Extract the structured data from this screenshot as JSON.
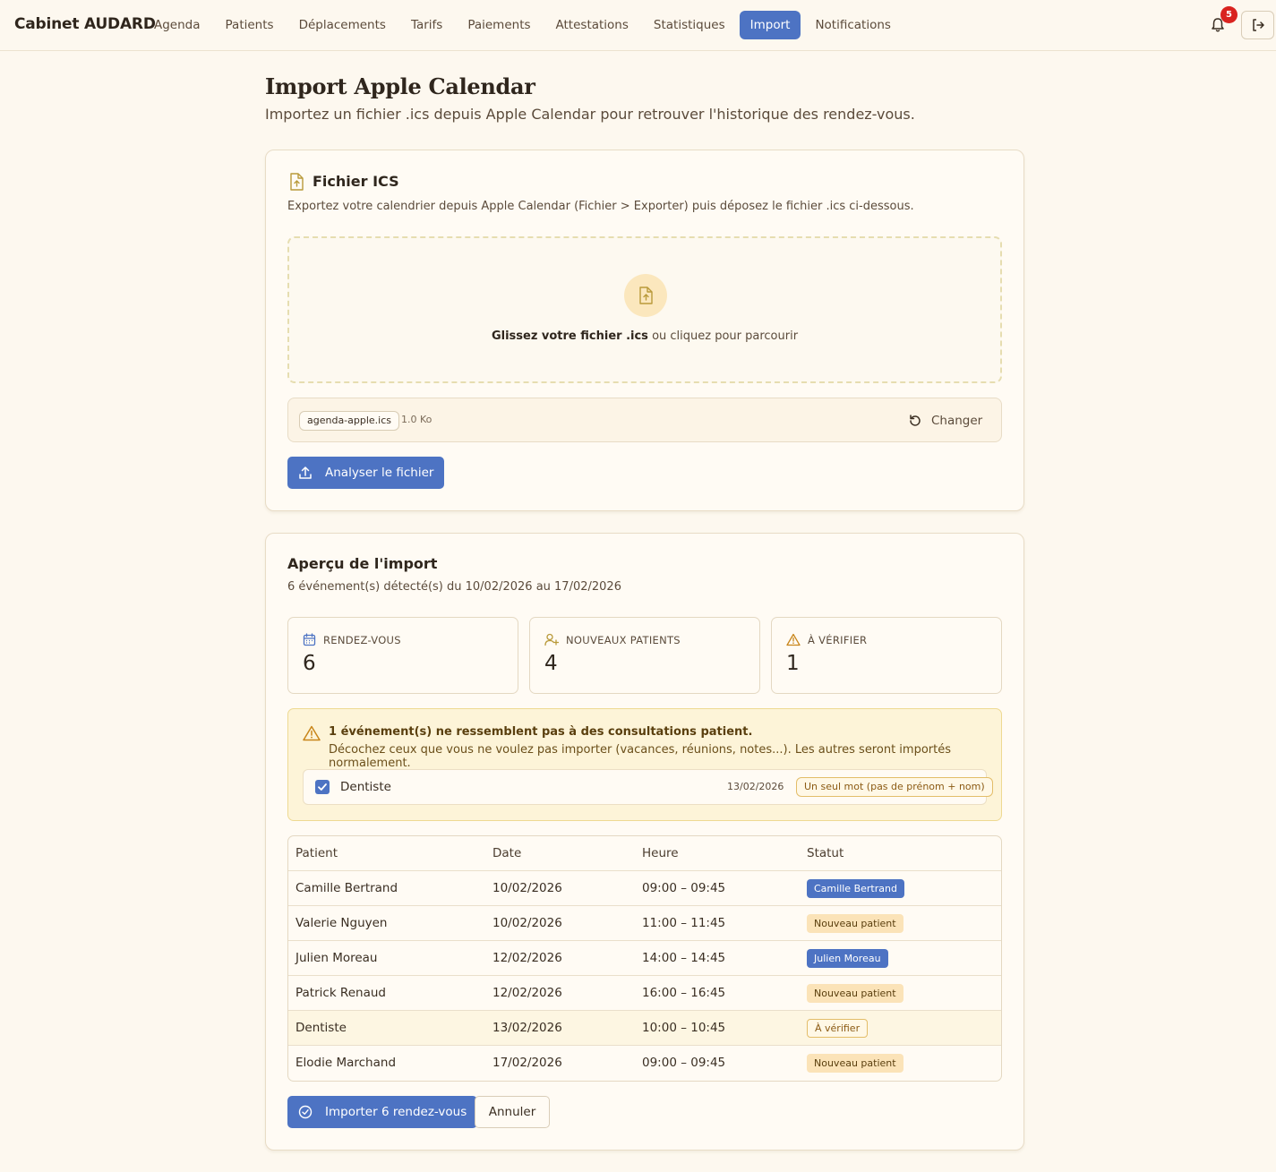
{
  "brand": "Cabinet AUDARD",
  "nav": [
    {
      "label": "Agenda",
      "active": false
    },
    {
      "label": "Patients",
      "active": false
    },
    {
      "label": "Déplacements",
      "active": false
    },
    {
      "label": "Tarifs",
      "active": false
    },
    {
      "label": "Paiements",
      "active": false
    },
    {
      "label": "Attestations",
      "active": false
    },
    {
      "label": "Statistiques",
      "active": false
    },
    {
      "label": "Import",
      "active": true
    },
    {
      "label": "Notifications",
      "active": false
    }
  ],
  "notifications_count": "5",
  "page": {
    "title": "Import Apple Calendar",
    "subtitle": "Importez un fichier .ics depuis Apple Calendar pour retrouver l'historique des rendez-vous."
  },
  "file_card": {
    "title": "Fichier ICS",
    "description": "Exportez votre calendrier depuis Apple Calendar (Fichier > Exporter) puis déposez le fichier .ics ci-dessous.",
    "dropzone_bold": "Glissez votre fichier .ics",
    "dropzone_rest": " ou cliquez pour parcourir",
    "file_name": "agenda-apple.ics",
    "file_size": "1.0 Ko",
    "change_label": "Changer",
    "analyze_label": "Analyser le fichier"
  },
  "preview": {
    "title": "Aperçu de l'import",
    "summary": "6 événement(s) détecté(s) du 10/02/2026 au 17/02/2026",
    "stats": [
      {
        "label": "RENDEZ-VOUS",
        "value": "6",
        "icon": "calendar-icon"
      },
      {
        "label": "NOUVEAUX PATIENTS",
        "value": "4",
        "icon": "user-plus-icon"
      },
      {
        "label": "À VÉRIFIER",
        "value": "1",
        "icon": "warning-icon"
      }
    ],
    "warning": {
      "title": "1 événement(s) ne ressemblent pas à des consultations patient.",
      "description": "Décochez ceux que vous ne voulez pas importer (vacances, réunions, notes...). Les autres seront importés normalement.",
      "item": {
        "name": "Dentiste",
        "date": "13/02/2026",
        "reason": "Un seul mot (pas de prénom + nom)",
        "checked": true
      }
    },
    "table": {
      "headers": [
        "Patient",
        "Date",
        "Heure",
        "Statut"
      ],
      "rows": [
        {
          "patient": "Camille Bertrand",
          "date": "10/02/2026",
          "time": "09:00 – 09:45",
          "status": "Camille Bertrand",
          "status_type": "blue"
        },
        {
          "patient": "Valerie Nguyen",
          "date": "10/02/2026",
          "time": "11:00 – 11:45",
          "status": "Nouveau patient",
          "status_type": "beige"
        },
        {
          "patient": "Julien Moreau",
          "date": "12/02/2026",
          "time": "14:00 – 14:45",
          "status": "Julien Moreau",
          "status_type": "blue"
        },
        {
          "patient": "Patrick Renaud",
          "date": "12/02/2026",
          "time": "16:00 – 16:45",
          "status": "Nouveau patient",
          "status_type": "beige"
        },
        {
          "patient": "Dentiste",
          "date": "13/02/2026",
          "time": "10:00 – 10:45",
          "status": "À vérifier",
          "status_type": "outline"
        },
        {
          "patient": "Elodie Marchand",
          "date": "17/02/2026",
          "time": "09:00 – 09:45",
          "status": "Nouveau patient",
          "status_type": "beige"
        }
      ]
    },
    "import_label": "Importer 6 rendez-vous",
    "cancel_label": "Annuler"
  }
}
